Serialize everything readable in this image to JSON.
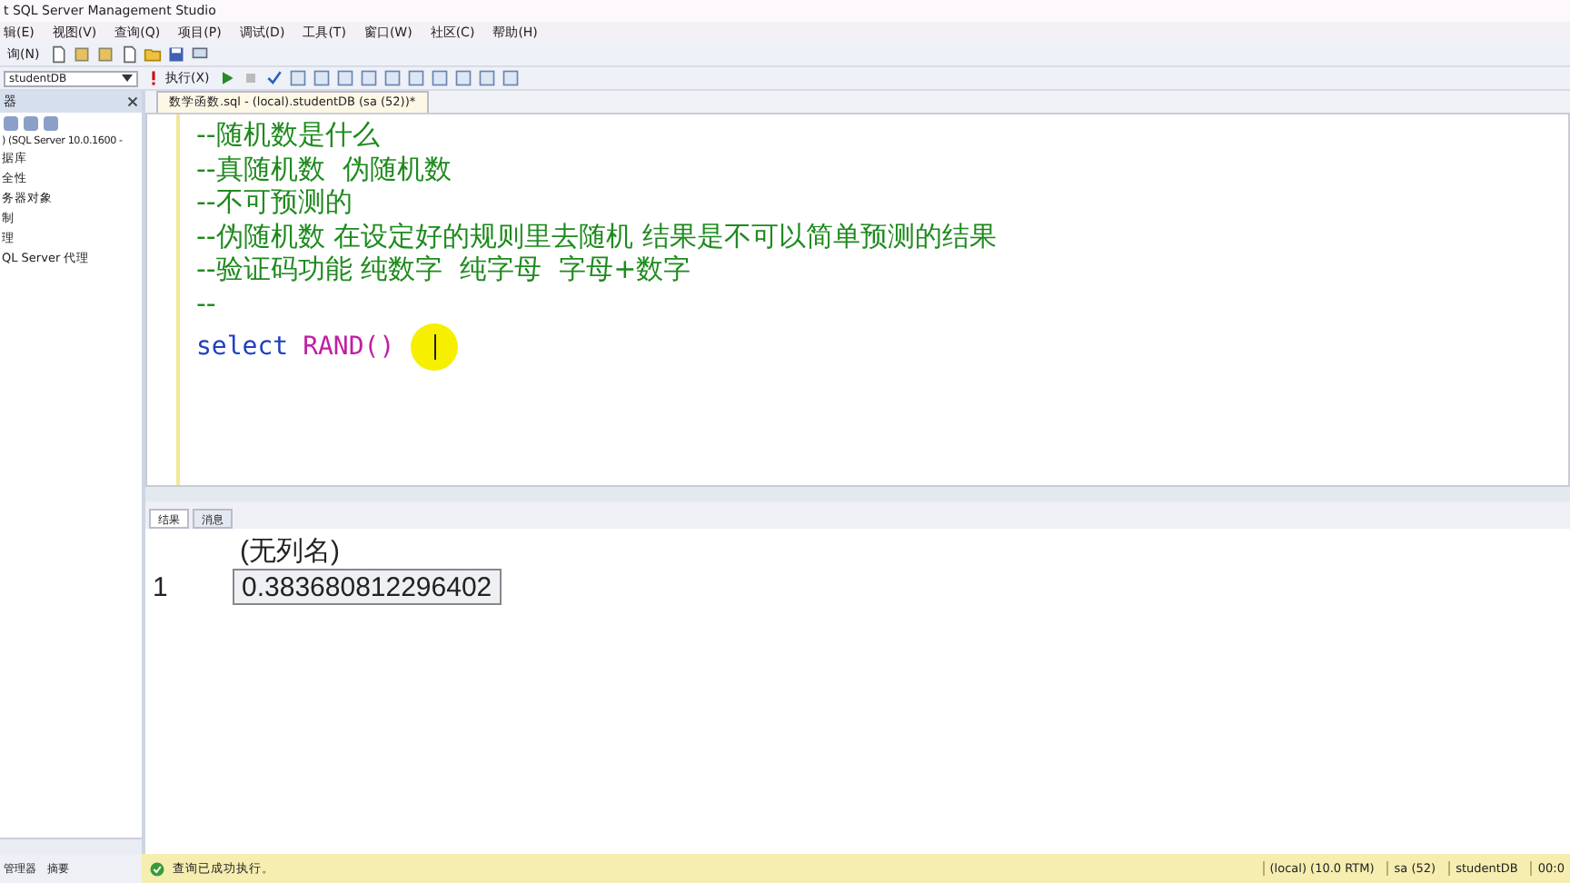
{
  "window": {
    "title": "t SQL Server Management Studio"
  },
  "menu": [
    "辑(E)",
    "视图(V)",
    "查询(Q)",
    "项目(P)",
    "调试(D)",
    "工具(T)",
    "窗口(W)",
    "社区(C)",
    "帮助(H)"
  ],
  "toolbar": {
    "new_query": "询(N)",
    "database": "studentDB",
    "execute": "执行(X)"
  },
  "object_explorer": {
    "title": "器",
    "tree": [
      {
        "label": ") (SQL Server 10.0.1600 -",
        "children": [
          {
            "label": "据库"
          },
          {
            "label": "全性"
          },
          {
            "label": "务器对象"
          },
          {
            "label": "制"
          },
          {
            "label": "理"
          },
          {
            "label": "QL Server 代理"
          }
        ]
      }
    ]
  },
  "editor": {
    "tab": "数学函数.sql - (local).studentDB (sa (52))*",
    "lines": [
      {
        "kind": "comment",
        "text": "--随机数是什么"
      },
      {
        "kind": "comment",
        "text": "--真随机数  伪随机数"
      },
      {
        "kind": "comment",
        "text": "--不可预测的"
      },
      {
        "kind": "comment",
        "text": "--伪随机数 在设定好的规则里去随机 结果是不可以简单预测的结果"
      },
      {
        "kind": "comment",
        "text": "--验证码功能 纯数字  纯字母  字母+数字"
      },
      {
        "kind": "comment",
        "text": "--"
      },
      {
        "kind": "code",
        "keyword": "select",
        "function": "RAND()",
        "cursor": true
      }
    ]
  },
  "results": {
    "tabs": [
      {
        "label": "结果",
        "selected": true
      },
      {
        "label": "消息",
        "selected": false
      }
    ],
    "column": "(无列名)",
    "rows": [
      {
        "number": "1",
        "value": "0.383680812296402"
      }
    ]
  },
  "bottom_tabs": [
    "管理器",
    "摘要"
  ],
  "status_bar": {
    "message": "查询已成功执行。",
    "server": "(local) (10.0 RTM)",
    "user": "sa (52)",
    "database": "studentDB",
    "time": "00:0"
  }
}
